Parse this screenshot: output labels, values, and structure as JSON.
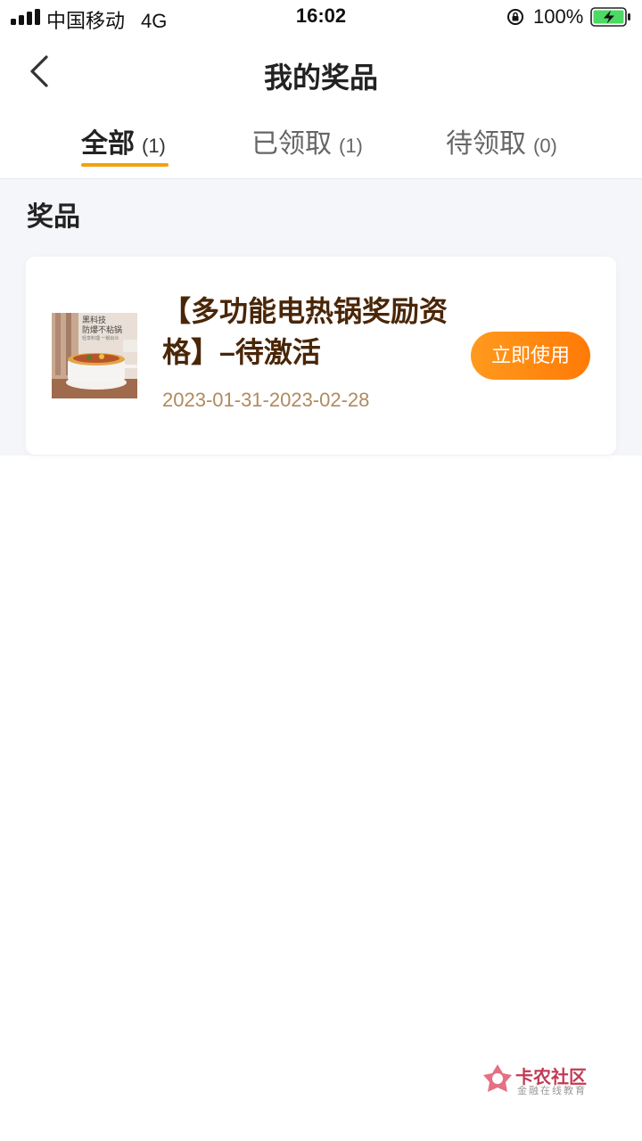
{
  "status_bar": {
    "carrier": "中国移动",
    "network": "4G",
    "time": "16:02",
    "battery": "100%"
  },
  "header": {
    "title": "我的奖品"
  },
  "tabs": [
    {
      "label": "全部",
      "count": "(1)",
      "active": true
    },
    {
      "label": "已领取",
      "count": "(1)",
      "active": false
    },
    {
      "label": "待领取",
      "count": "(0)",
      "active": false
    }
  ],
  "section": {
    "title": "奖品"
  },
  "prize": {
    "name": "【多功能电热锅奖励资格】–待激活",
    "date_range": "2023-01-31-2023-02-28",
    "action_label": "立即使用",
    "thumb_text_1": "黑科技",
    "thumb_text_2": "防爆不粘锅",
    "thumb_text_3": "轻享料理 一锅出众"
  },
  "watermark": {
    "title": "卡农社区",
    "subtitle": "金融在线教育"
  },
  "colors": {
    "accent": "#f5a10d",
    "button_start": "#ff9a1e",
    "button_end": "#ff7a06",
    "prize_title": "#4a2608",
    "date": "#b08a5e"
  }
}
